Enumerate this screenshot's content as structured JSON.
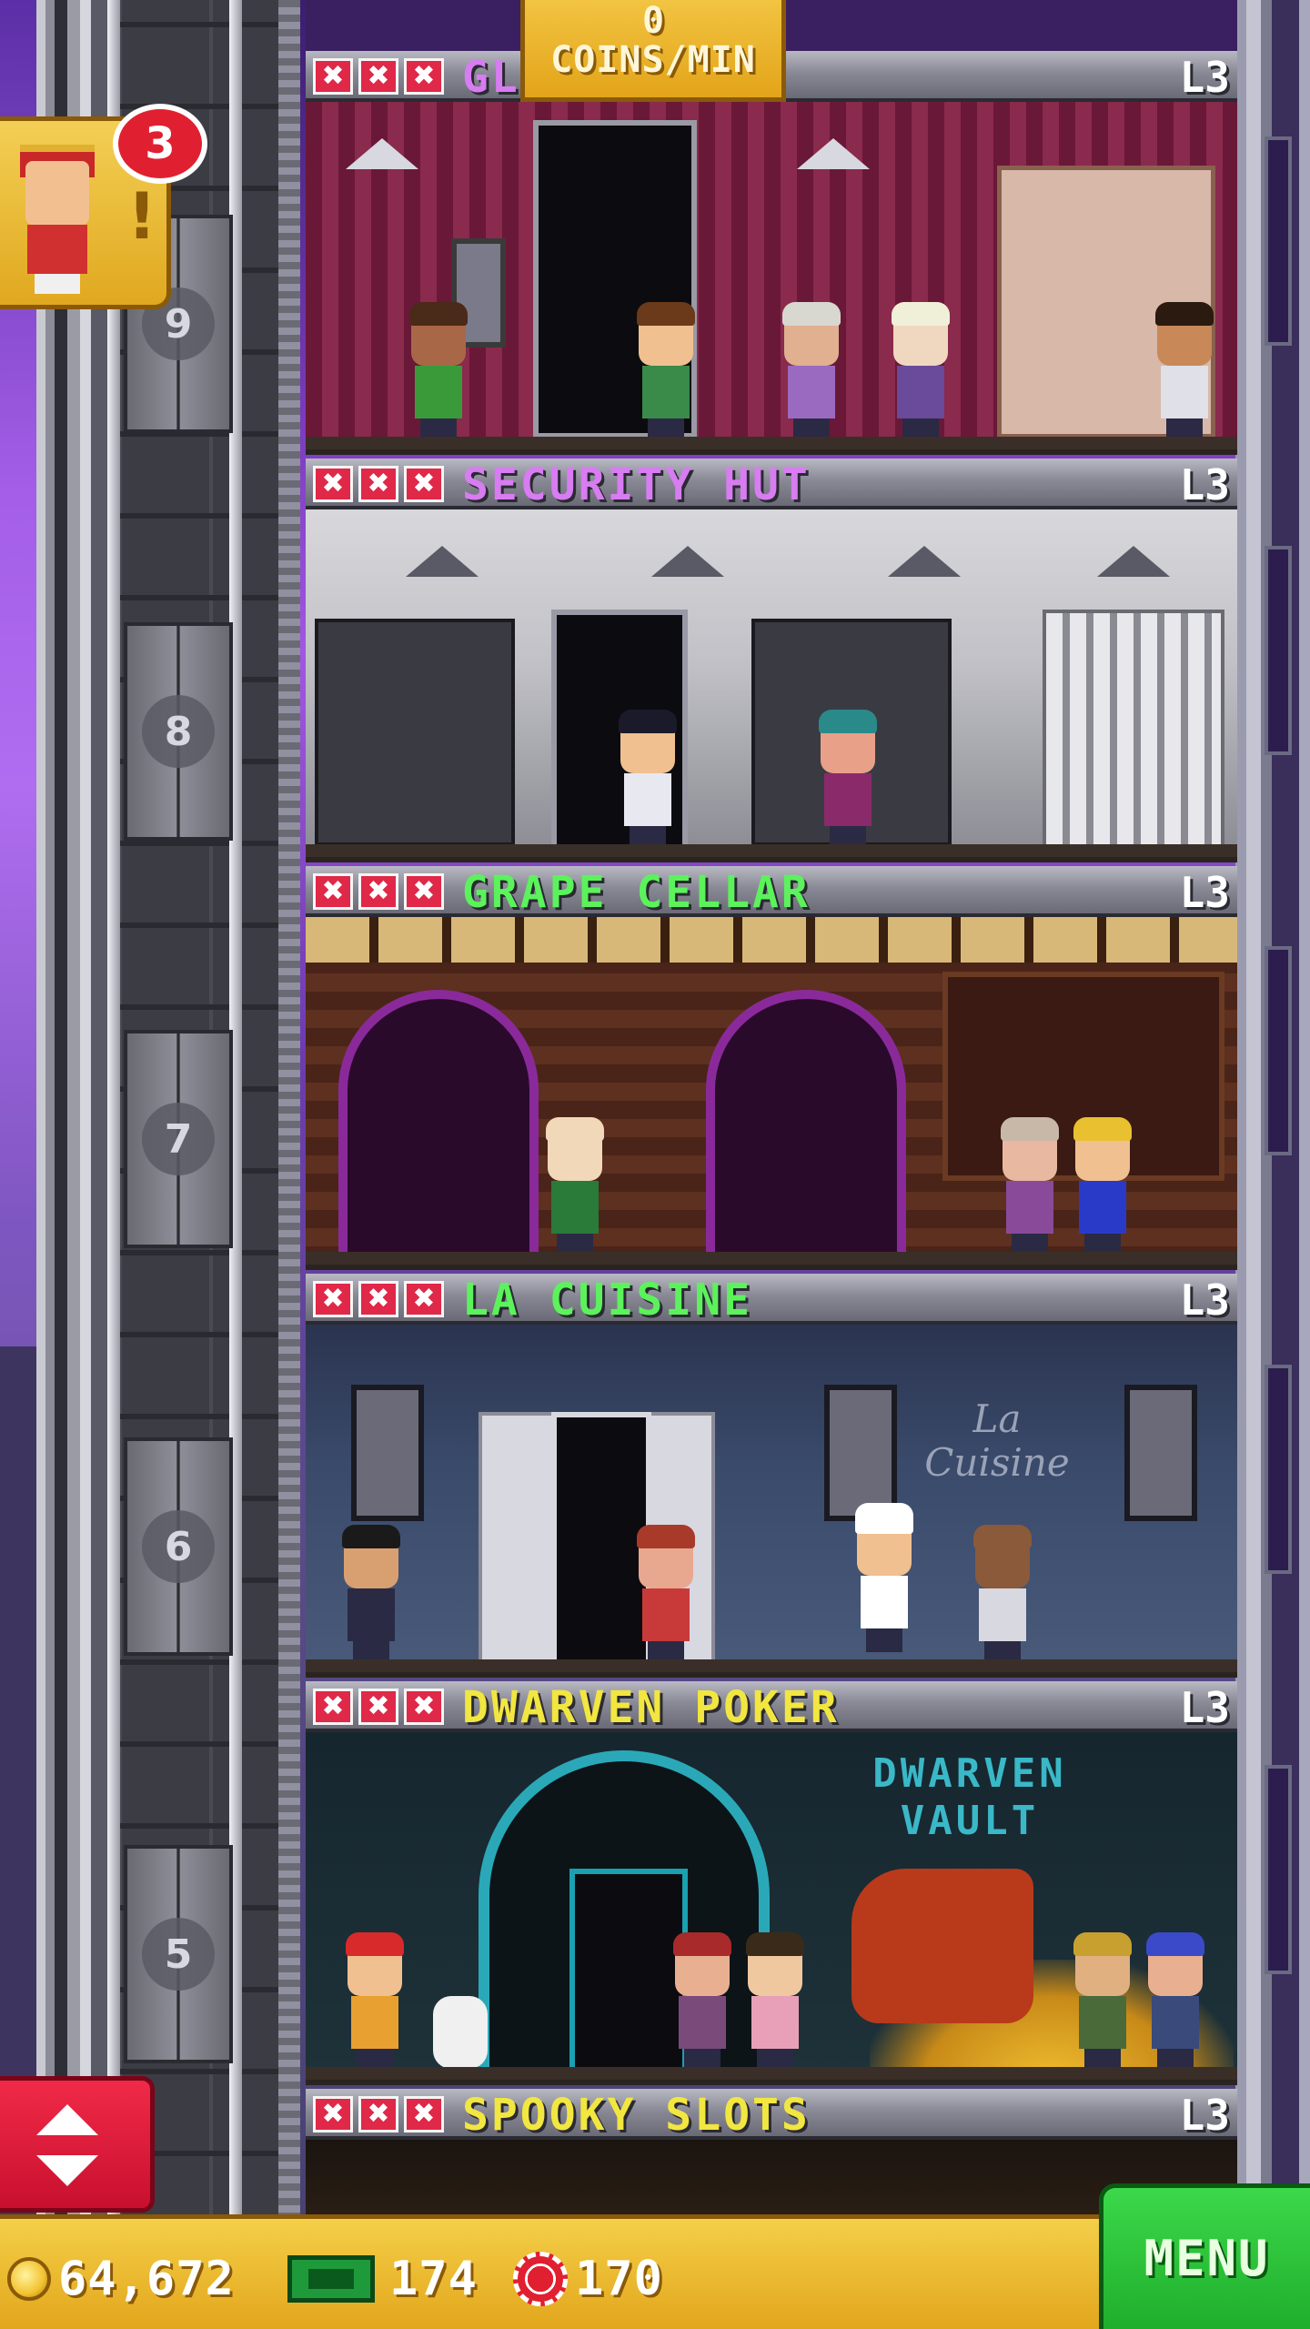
{
  "coins_per_min": {
    "value": "0",
    "unit": "COINS/MIN"
  },
  "notifications": {
    "bellhop_count": "3",
    "bellhop_exclaim": "!"
  },
  "shaft_floor_numbers": [
    "9",
    "8",
    "7",
    "6",
    "5"
  ],
  "floors": [
    {
      "name": "GL",
      "level": "L3",
      "name_color": "#d87cf2",
      "star_mark": "✖"
    },
    {
      "name": "SECURITY HUT",
      "level": "L3",
      "name_color": "#d87cf2",
      "star_mark": "✖"
    },
    {
      "name": "GRAPE CELLAR",
      "level": "L3",
      "name_color": "#5cf25c",
      "star_mark": "✖"
    },
    {
      "name": "LA CUISINE",
      "level": "L3",
      "name_color": "#5cf25c",
      "star_mark": "✖"
    },
    {
      "name": "DWARVEN POKER",
      "level": "L3",
      "name_color": "#f2e640",
      "star_mark": "✖"
    },
    {
      "name": "SPOOKY SLOTS",
      "level": "L3",
      "name_color": "#f2e640",
      "star_mark": "✖"
    }
  ],
  "room_signs": {
    "la_cuisine": "La Cuisine",
    "dwarven_vault": "DWARVEN VAULT"
  },
  "bottom_bar": {
    "coins": "64,672",
    "bux": "174",
    "chips": "170",
    "menu_label": "MENU"
  },
  "icons": {
    "coin": "coin-icon",
    "bux": "bux-icon",
    "chip": "chip-icon",
    "elevator_up": "arrow-up-icon",
    "elevator_down": "arrow-down-icon"
  },
  "colors": {
    "banner_gold": "#e3a41a",
    "star_red": "#e02848",
    "menu_green": "#1fae2c",
    "elevator_red": "#c8102e"
  }
}
